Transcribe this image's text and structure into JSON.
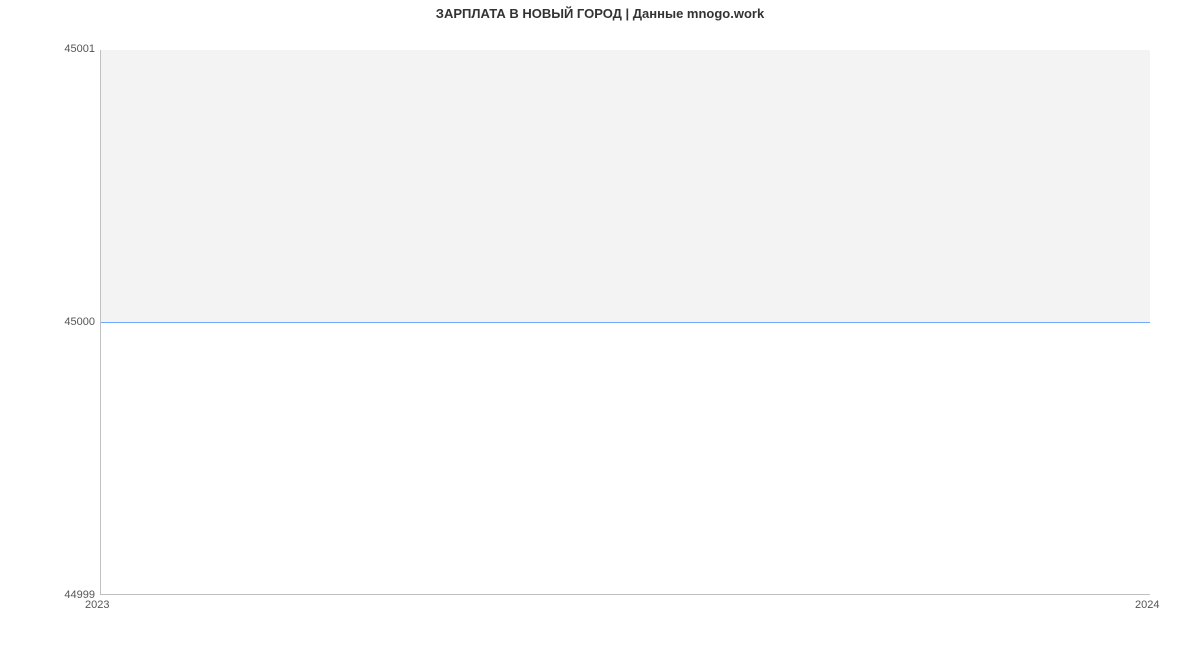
{
  "chart_data": {
    "type": "line",
    "title": "ЗАРПЛАТА В НОВЫЙ ГОРОД | Данные mnogo.work",
    "x": [
      "2023",
      "2024"
    ],
    "values": [
      45000,
      45000
    ],
    "xlabel": "",
    "ylabel": "",
    "xlim": [
      "2023",
      "2024"
    ],
    "ylim": [
      44999,
      45001
    ],
    "yticks": [
      44999,
      45000,
      45001
    ],
    "xticks": [
      "2023",
      "2024"
    ]
  }
}
